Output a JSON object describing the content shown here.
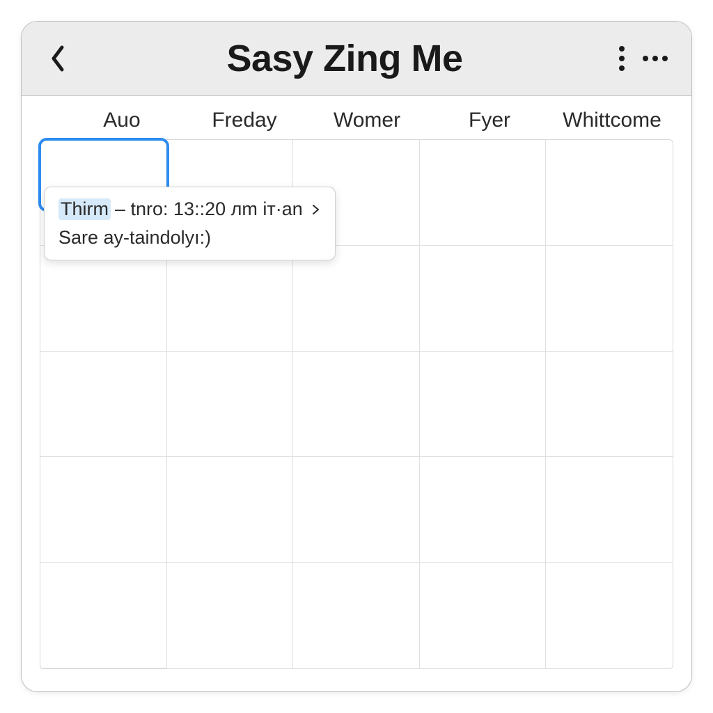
{
  "header": {
    "title": "Sasy Zing Me"
  },
  "calendar": {
    "columns": [
      "Auo",
      "Freday",
      "Womer",
      "Fyer",
      "Whittcome"
    ],
    "rows": 5,
    "selected_cell": {
      "row": 0,
      "col": 0
    }
  },
  "popup": {
    "line1_prefix": "Thirm",
    "line1_rest": "– tnro: 13::20 лm iт·an",
    "line2": "Sare ay-taindolyı:)"
  },
  "icons": {
    "back": "chevron-left-icon",
    "menu_vertical": "kebab-menu-icon",
    "menu_horizontal": "more-horizontal-icon",
    "popup_arrow": "chevron-right-small-icon"
  }
}
